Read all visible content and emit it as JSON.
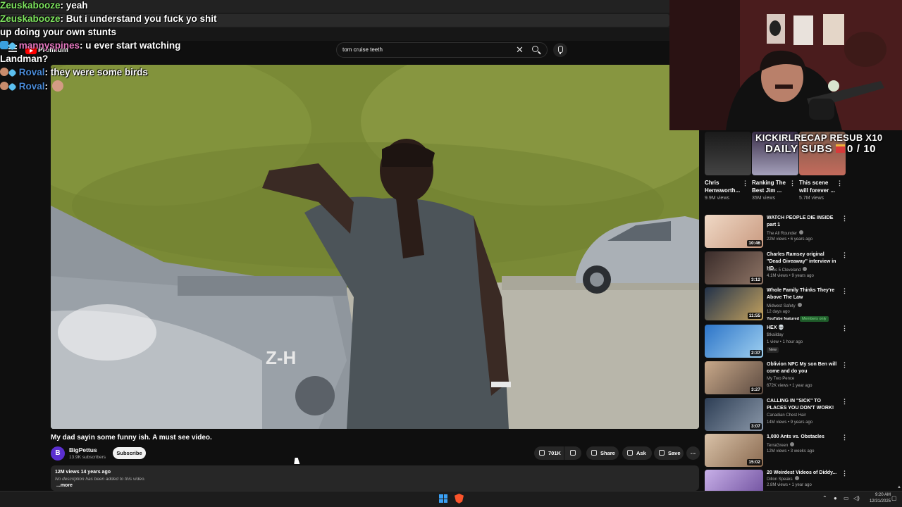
{
  "chat": [
    {
      "user": "Zeuskabooze",
      "sep": ":",
      "msg": " yeah",
      "color": "#7ee35f"
    },
    {
      "user": "Zeuskabooze",
      "sep": ":",
      "msg": " But i understand you fuck yo shit",
      "color": "#7ee35f"
    },
    {
      "user": "",
      "sep": "",
      "msg": "up doing your own stunts",
      "color": "#ffffff"
    },
    {
      "user": "mannyspines",
      "sep": ":",
      "msg": " u ever start watching",
      "color": "#e678c0"
    },
    {
      "user": "",
      "sep": "",
      "msg": "Landman?",
      "color": "#ffffff"
    },
    {
      "user": "Roval",
      "sep": ":",
      "msg": " they were some birds",
      "color": "#4a8bd8"
    },
    {
      "user": "Roval",
      "sep": ":",
      "msg": "",
      "color": "#4a8bd8"
    }
  ],
  "header": {
    "premium_label": "Premium",
    "search_value": "tom cruise teeth"
  },
  "video": {
    "title": "My dad sayin some funny ish. A must see video.",
    "channel": "BigPettus",
    "avatar_letter": "B",
    "subscribers": "13.9K subscribers",
    "subscribe_label": "Subscribe",
    "likes": "701K",
    "share_label": "Share",
    "ask_label": "Ask",
    "save_label": "Save",
    "views_age": "12M views  14 years ago",
    "description": "No description has been added to this video.",
    "more_label": "...more"
  },
  "overlay": {
    "line1": "KICKIRLRECAP RESUB X10",
    "line2": "DAILY SUBS",
    "count": "0 / 10"
  },
  "shorts": [
    {
      "title": "Chris Hemsworth...",
      "views": "9.9M views"
    },
    {
      "title": "Ranking The Best Jim ...",
      "views": "35M views"
    },
    {
      "title": "This scene will forever ...",
      "views": "5.7M views"
    }
  ],
  "recommendations": [
    {
      "title": "WATCH PEOPLE DIE INSIDE part 1",
      "channel": "The All Rounder",
      "meta": "22M views • 6 years ago",
      "duration": "10:46",
      "verified": true,
      "tag": ""
    },
    {
      "title": "Charles Ramsey original \"Dead Giveaway\" interview in HD",
      "channel": "News 5 Cleveland",
      "meta": "4.1M views • 9 years ago",
      "duration": "3:12",
      "verified": true,
      "tag": ""
    },
    {
      "title": "Whole Family Thinks They're Above The Law",
      "channel": "Midwest Safety",
      "meta": "12 days ago",
      "duration": "11:55",
      "verified": true,
      "tag": "YouTube featured",
      "tag2": "Members only"
    },
    {
      "title": "HEX 💀",
      "channel": "$tkailday",
      "meta": "1 view • 1 hour ago",
      "duration": "2:37",
      "verified": false,
      "tag": "New"
    },
    {
      "title": "Oblivion NPC My son Ben will come and do you",
      "channel": "My Two Pence",
      "meta": "672K views • 1 year ago",
      "duration": "3:27",
      "verified": false,
      "tag": ""
    },
    {
      "title": "CALLING IN \"SICK\" TO PLACES YOU DON'T WORK!",
      "channel": "Canadian Chest Hair",
      "meta": "14M views • 9 years ago",
      "duration": "3:07",
      "verified": false,
      "tag": ""
    },
    {
      "title": "1,000 Ants vs. Obstacles",
      "channel": "TerraGreen",
      "meta": "12M views • 3 weeks ago",
      "duration": "15:02",
      "verified": true,
      "tag": ""
    },
    {
      "title": "20 Weirdest Videos of Diddy...",
      "channel": "Dillon Speaks",
      "meta": "2.8M views • 1 year ago",
      "duration": "",
      "verified": true,
      "tag": ""
    }
  ],
  "taskbar": {
    "time": "9:20 AM",
    "date": "12/31/2025"
  },
  "colors": {
    "background": "#0f0f0f",
    "youtube_red": "#ff0000",
    "members_only_green": "#7fe08a"
  }
}
